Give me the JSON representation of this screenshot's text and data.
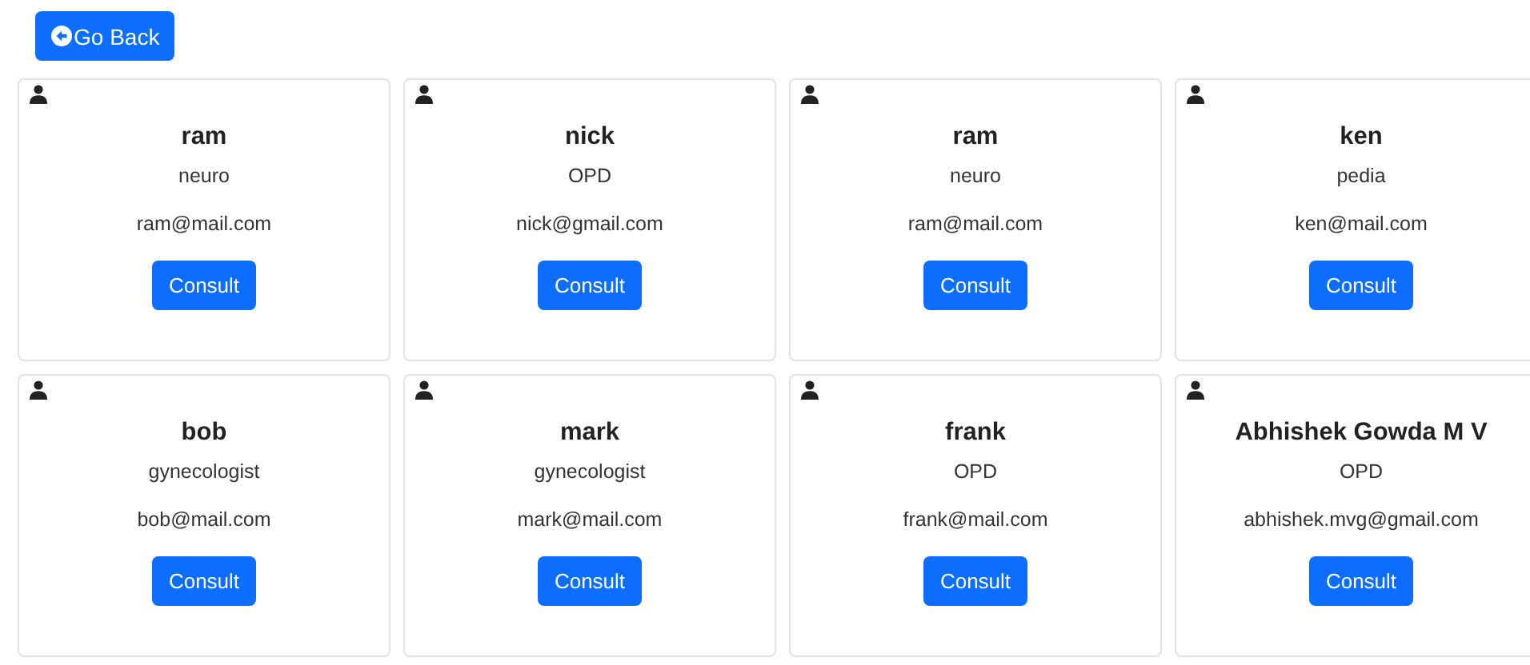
{
  "back_button": {
    "label": "Go Back"
  },
  "doctors": [
    {
      "name": "ram",
      "specialty": "neuro",
      "email": "ram@mail.com",
      "action": "Consult"
    },
    {
      "name": "nick",
      "specialty": "OPD",
      "email": "nick@gmail.com",
      "action": "Consult"
    },
    {
      "name": "ram",
      "specialty": "neuro",
      "email": "ram@mail.com",
      "action": "Consult"
    },
    {
      "name": "ken",
      "specialty": "pedia",
      "email": "ken@mail.com",
      "action": "Consult"
    },
    {
      "name": "bob",
      "specialty": "gynecologist",
      "email": "bob@mail.com",
      "action": "Consult"
    },
    {
      "name": "mark",
      "specialty": "gynecologist",
      "email": "mark@mail.com",
      "action": "Consult"
    },
    {
      "name": "frank",
      "specialty": "OPD",
      "email": "frank@mail.com",
      "action": "Consult"
    },
    {
      "name": "Abhishek Gowda M V",
      "specialty": "OPD",
      "email": "abhishek.mvg@gmail.com",
      "action": "Consult"
    }
  ]
}
